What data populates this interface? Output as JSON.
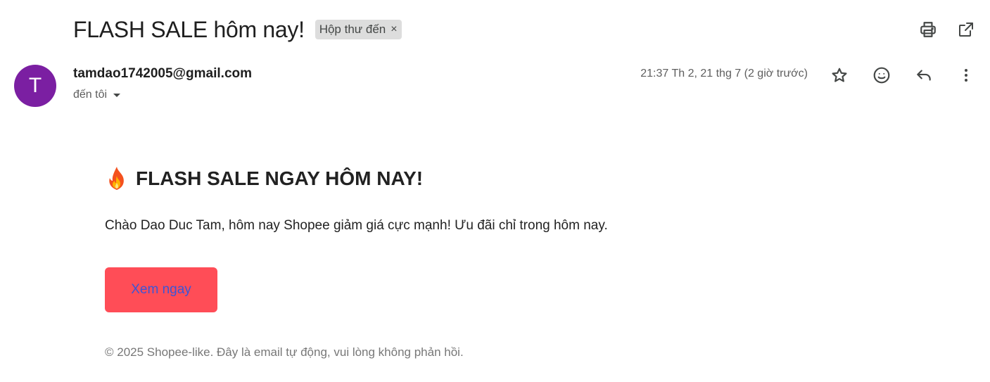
{
  "email": {
    "subject": "FLASH SALE hôm nay!",
    "label_chip": "Hộp thư đến",
    "label_remove_glyph": "×",
    "toolbar_icons": [
      "print-icon",
      "open-in-new-window-icon"
    ],
    "sender": {
      "avatar_letter": "T",
      "avatar_color": "#7b1fa2",
      "address": "tamdao1742005@gmail.com",
      "recipient_label": "đến tôi",
      "timestamp": "21:37 Th 2, 21 thg 7 (2 giờ trước)"
    },
    "actions": [
      "star-icon",
      "emoji-icon",
      "reply-icon",
      "more-vert-icon"
    ]
  },
  "message": {
    "headline_icon": "fire-emoji",
    "headline": "FLASH SALE NGAY HÔM NAY!",
    "intro": "Chào Dao Duc Tam, hôm nay Shopee giảm giá cực mạnh! Ưu đãi chỉ trong hôm nay.",
    "cta_label": "Xem ngay",
    "cta_bg_color": "#ff4d57",
    "cta_text_color": "#3c55d6",
    "footer": "© 2025 Shopee-like. Đây là email tự động, vui lòng không phản hồi."
  }
}
